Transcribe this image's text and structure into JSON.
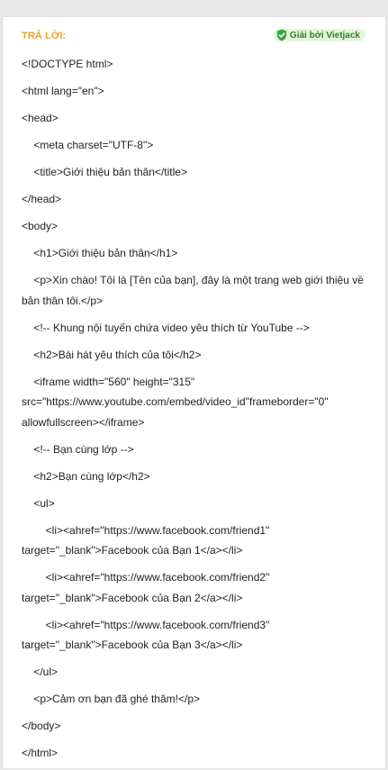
{
  "answer": {
    "heading": "TRẢ LỜI:",
    "badge_label": "Giải bởi Vietjack",
    "badge_icon": "shield-check-icon",
    "accent_color": "#f0a01e",
    "badge_color": "#2e7d32",
    "lines": [
      "<!DOCTYPE html>",
      "<html lang=\"en\">",
      "<head>",
      "    <meta charset=\"UTF-8\">",
      "    <title>Giới thiệu bản thân</title>",
      "</head>",
      "<body>",
      "    <h1>Giới thiệu bản thân</h1>",
      "    <p>Xin chào! Tôi là [Tên của bạn], đây là một trang web giới thiệu về bản thân tôi.</p>",
      "    <!-- Khung nội tuyến chứa video yêu thích từ YouTube -->",
      "    <h2>Bài hát yêu thích của tôi</h2>",
      "    <iframe width=\"560\" height=\"315\" src=\"https://www.youtube.com/embed/video_id\"frameborder=\"0\" allowfullscreen></iframe>",
      "    <!-- Bạn cùng lớp -->",
      "    <h2>Bạn cùng lớp</h2>",
      "    <ul>",
      "        <li><ahref=\"https://www.facebook.com/friend1\" target=\"_blank\">Facebook của Bạn 1</a></li>",
      "        <li><ahref=\"https://www.facebook.com/friend2\" target=\"_blank\">Facebook của Bạn 2</a></li>",
      "        <li><ahref=\"https://www.facebook.com/friend3\" target=\"_blank\">Facebook của Bạn 3</a></li>",
      "    </ul>",
      "    <p>Cảm ơn bạn đã ghé thăm!</p>",
      "</body>",
      "</html>"
    ]
  }
}
